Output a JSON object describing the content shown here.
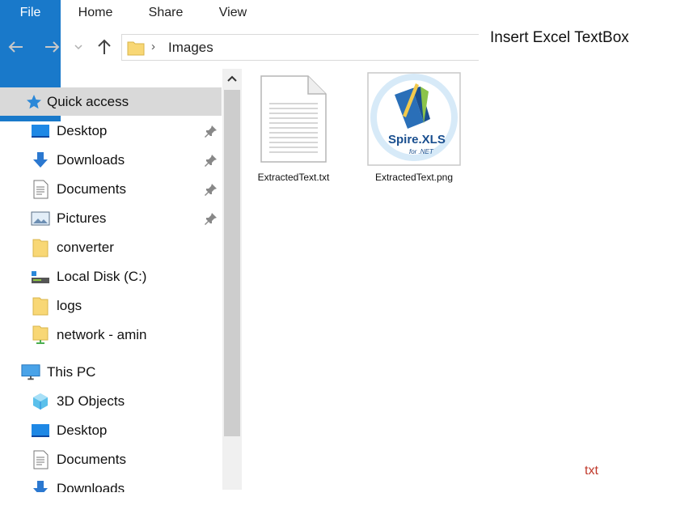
{
  "ribbon": {
    "tabs": [
      "File",
      "Home",
      "Share",
      "View"
    ],
    "accent": "#1979ca"
  },
  "address_bar": {
    "crumbs": [
      "Images"
    ]
  },
  "navigation_pane": {
    "quick_access_label": "Quick access",
    "quick_access_items": [
      {
        "label": "Desktop",
        "icon": "desktop-icon",
        "pinned": true
      },
      {
        "label": "Downloads",
        "icon": "downloads-icon",
        "pinned": true
      },
      {
        "label": "Documents",
        "icon": "documents-icon",
        "pinned": true
      },
      {
        "label": "Pictures",
        "icon": "pictures-icon",
        "pinned": true
      },
      {
        "label": "converter",
        "icon": "folder-icon",
        "pinned": false
      },
      {
        "label": "Local Disk (C:)",
        "icon": "local-disk-icon",
        "pinned": false
      },
      {
        "label": "logs",
        "icon": "folder-icon",
        "pinned": false
      },
      {
        "label": "network - amin",
        "icon": "network-folder-icon",
        "pinned": false
      }
    ],
    "this_pc_label": "This PC",
    "this_pc_items": [
      {
        "label": "3D Objects",
        "icon": "3d-objects-icon"
      },
      {
        "label": "Desktop",
        "icon": "desktop-icon"
      },
      {
        "label": "Documents",
        "icon": "documents-icon"
      },
      {
        "label": "Downloads",
        "icon": "downloads-icon"
      }
    ]
  },
  "files": [
    {
      "name": "ExtractedText.txt",
      "icon": "text-file-icon"
    },
    {
      "name": "ExtractedText.png",
      "icon": "spire-xls-logo-icon",
      "logo_text": [
        "Spire.XLS",
        "for .NET"
      ]
    }
  ],
  "annotation_title": "Insert Excel TextBox",
  "annotation_label": "txt"
}
